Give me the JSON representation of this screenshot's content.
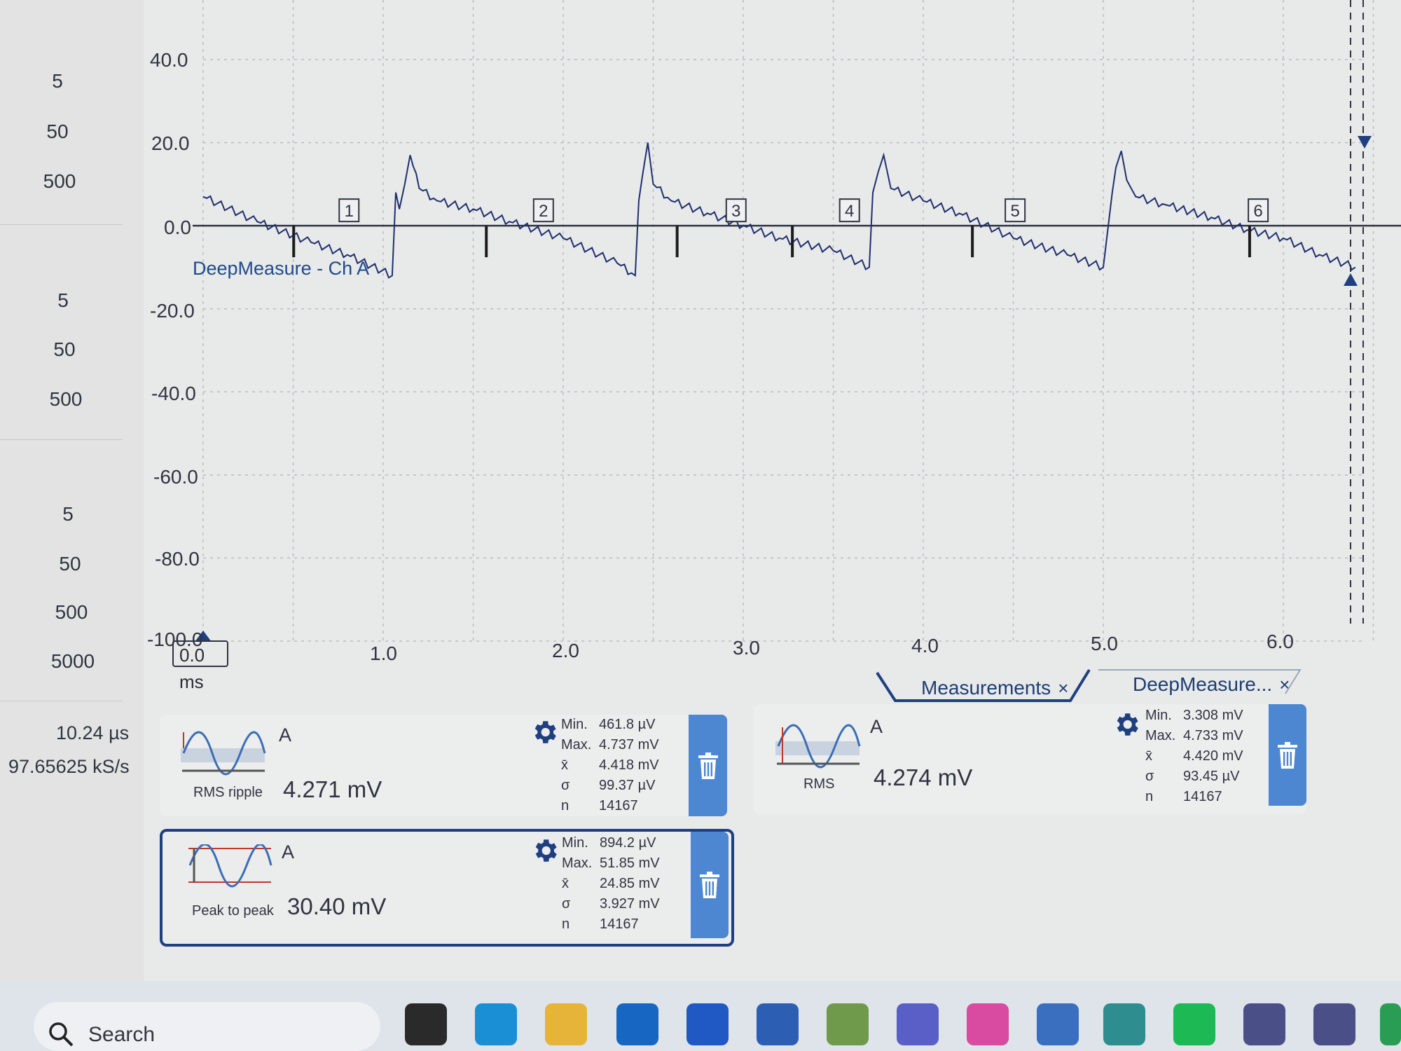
{
  "left_panel": {
    "groups": [
      [
        "5",
        "50",
        "500"
      ],
      [
        "5",
        "50",
        "500"
      ],
      [
        "5",
        "50",
        "500",
        "5000"
      ]
    ],
    "sample_interval": "10.24 µs",
    "sample_rate": "97.65625 kS/s"
  },
  "chart_data": {
    "type": "line",
    "title": "",
    "xlabel": "",
    "ylabel": "",
    "x_unit_label": "0.0 ms",
    "x_ticks": [
      "1.0",
      "2.0",
      "3.0",
      "4.0",
      "5.0",
      "6.0"
    ],
    "y_ticks": [
      "40.0",
      "20.0",
      "0.0",
      "-20.0",
      "-40.0",
      "-60.0",
      "-80.0",
      "-100.0"
    ],
    "xlim": [
      0,
      6.5
    ],
    "ylim": [
      -100,
      40
    ],
    "grid": true,
    "series": [
      {
        "name": "DeepMeasure - Ch A",
        "color": "#1f2f6e",
        "x": [
          0,
          0.3,
          0.6,
          0.8,
          1.05,
          1.07,
          1.09,
          1.12,
          1.15,
          1.2,
          1.3,
          1.5,
          1.7,
          2.0,
          2.3,
          2.4,
          2.42,
          2.44,
          2.47,
          2.5,
          2.6,
          2.8,
          3.0,
          3.2,
          3.5,
          3.7,
          3.72,
          3.75,
          3.78,
          3.82,
          4.0,
          4.2,
          4.5,
          4.8,
          5.0,
          5.05,
          5.07,
          5.1,
          5.13,
          5.18,
          5.35,
          5.6,
          5.8,
          6.0,
          6.2,
          6.4
        ],
        "y": [
          7,
          1,
          -4,
          -7,
          -12,
          8,
          4,
          10,
          17,
          9,
          6,
          4,
          1,
          -3,
          -9,
          -12,
          6,
          12,
          20,
          10,
          6,
          3,
          0,
          -3,
          -6,
          -10,
          8,
          13,
          17,
          9,
          6,
          3,
          -3,
          -7,
          -10,
          8,
          14,
          18,
          11,
          7,
          5,
          2,
          -1,
          -3,
          -7,
          -10
        ]
      }
    ],
    "markers": [
      "1",
      "2",
      "3",
      "4",
      "5",
      "6"
    ],
    "legend": "top-left"
  },
  "tabs": [
    {
      "label": "Measurements",
      "close": "×"
    },
    {
      "label": "DeepMeasure...",
      "close": "×"
    }
  ],
  "measurements": [
    {
      "channel": "A",
      "name": "RMS ripple",
      "value": "4.271 mV",
      "stats": {
        "min_k": "Min.",
        "min": "461.8 µV",
        "max_k": "Max.",
        "max": "4.737 mV",
        "mean_k": "x̄",
        "mean": "4.418 mV",
        "sd_k": "σ",
        "sd": "99.37 µV",
        "n_k": "n",
        "n": "14167"
      }
    },
    {
      "channel": "A",
      "name": "Peak to peak",
      "value": "30.40 mV",
      "stats": {
        "min_k": "Min.",
        "min": "894.2 µV",
        "max_k": "Max.",
        "max": "51.85 mV",
        "mean_k": "x̄",
        "mean": "24.85 mV",
        "sd_k": "σ",
        "sd": "3.927 mV",
        "n_k": "n",
        "n": "14167"
      }
    },
    {
      "channel": "A",
      "name": "RMS",
      "value": "4.274 mV",
      "stats": {
        "min_k": "Min.",
        "min": "3.308 mV",
        "max_k": "Max.",
        "max": "4.733 mV",
        "mean_k": "x̄",
        "mean": "4.420 mV",
        "sd_k": "σ",
        "sd": "93.45 µV",
        "n_k": "n",
        "n": "14167"
      }
    }
  ],
  "taskbar": {
    "search_label": "Search",
    "icons": [
      "task-view-icon",
      "edge-icon",
      "file-explorer-icon",
      "outlook-icon",
      "store-icon",
      "app-a-icon",
      "notepad-icon",
      "teams-icon",
      "copilot-icon",
      "remote-desktop-icon",
      "picoscope-icon",
      "spotify-icon",
      "picoscope-ps-icon",
      "picoscope-ps2-icon",
      "whatsapp-icon"
    ]
  }
}
